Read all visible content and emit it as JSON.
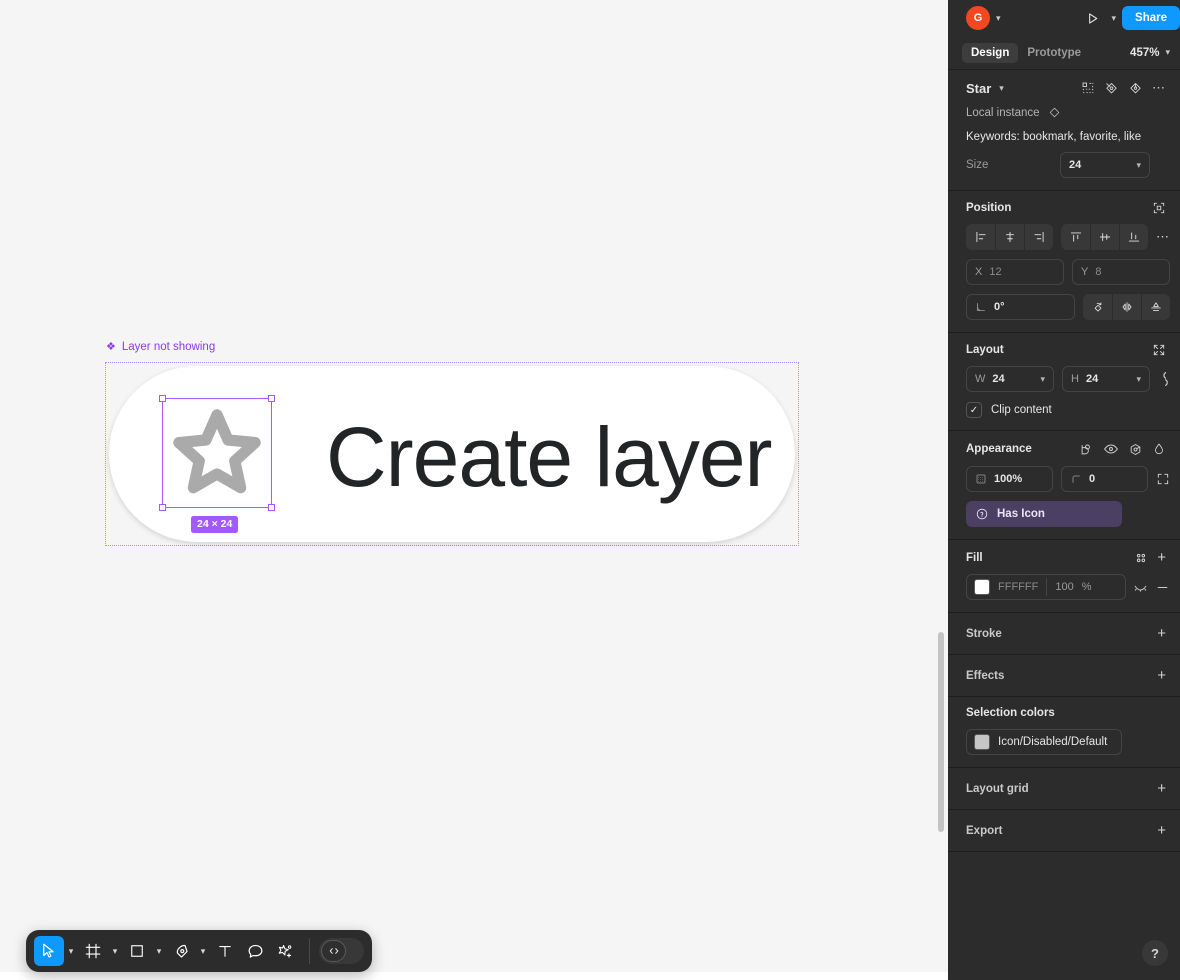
{
  "canvas": {
    "layer_not_showing": "Layer not showing",
    "button_label": "Create layer",
    "size_badge": "24 × 24",
    "selection_color": "#a259ff",
    "canvas_bg": "#f5f5f5",
    "star_fill": "#aaaaaa"
  },
  "toolbar": {
    "tools": [
      {
        "name": "move-tool",
        "label": "Move",
        "active": true,
        "has_caret": true
      },
      {
        "name": "frame-tool",
        "label": "Frame",
        "active": false,
        "has_caret": true
      },
      {
        "name": "shape-tool",
        "label": "Rectangle",
        "active": false,
        "has_caret": true
      },
      {
        "name": "pen-tool",
        "label": "Pen",
        "active": false,
        "has_caret": true
      },
      {
        "name": "text-tool",
        "label": "Text",
        "active": false,
        "has_caret": false
      },
      {
        "name": "comment-tool",
        "label": "Comment",
        "active": false,
        "has_caret": false
      },
      {
        "name": "actions-tool",
        "label": "Actions",
        "active": false,
        "has_caret": false
      }
    ],
    "devmode_label": "Dev Mode"
  },
  "header": {
    "avatar_initial": "G",
    "avatar_color": "#f24822",
    "share_label": "Share",
    "present_label": "Present",
    "accent_color": "#0d99ff"
  },
  "tabs": {
    "design": "Design",
    "prototype": "Prototype",
    "zoom": "457%"
  },
  "selection": {
    "name": "Star",
    "instance_label": "Local instance",
    "keywords": "Keywords: bookmark, favorite, like",
    "size_label": "Size",
    "size_value": "24"
  },
  "position": {
    "title": "Position",
    "x_label": "X",
    "x_value": "12",
    "y_label": "Y",
    "y_value": "8",
    "rotation_value": "0°"
  },
  "layout": {
    "title": "Layout",
    "w_label": "W",
    "w_value": "24",
    "h_label": "H",
    "h_value": "24",
    "clip_content_label": "Clip content",
    "clip_content_checked": true
  },
  "appearance": {
    "title": "Appearance",
    "opacity_value": "100%",
    "corner_radius_value": "0",
    "has_icon_label": "Has Icon",
    "has_icon_bg": "#4b3f63"
  },
  "fill": {
    "title": "Fill",
    "hex": "FFFFFF",
    "opacity": "100",
    "percent": "%",
    "swatch_color": "#ffffff"
  },
  "stroke": {
    "title": "Stroke"
  },
  "effects": {
    "title": "Effects"
  },
  "selection_colors": {
    "title": "Selection colors",
    "item_label": "Icon/Disabled/Default",
    "item_swatch": "#c6c6c6"
  },
  "layout_grid": {
    "title": "Layout grid"
  },
  "export": {
    "title": "Export"
  },
  "help": {
    "label": "?"
  }
}
